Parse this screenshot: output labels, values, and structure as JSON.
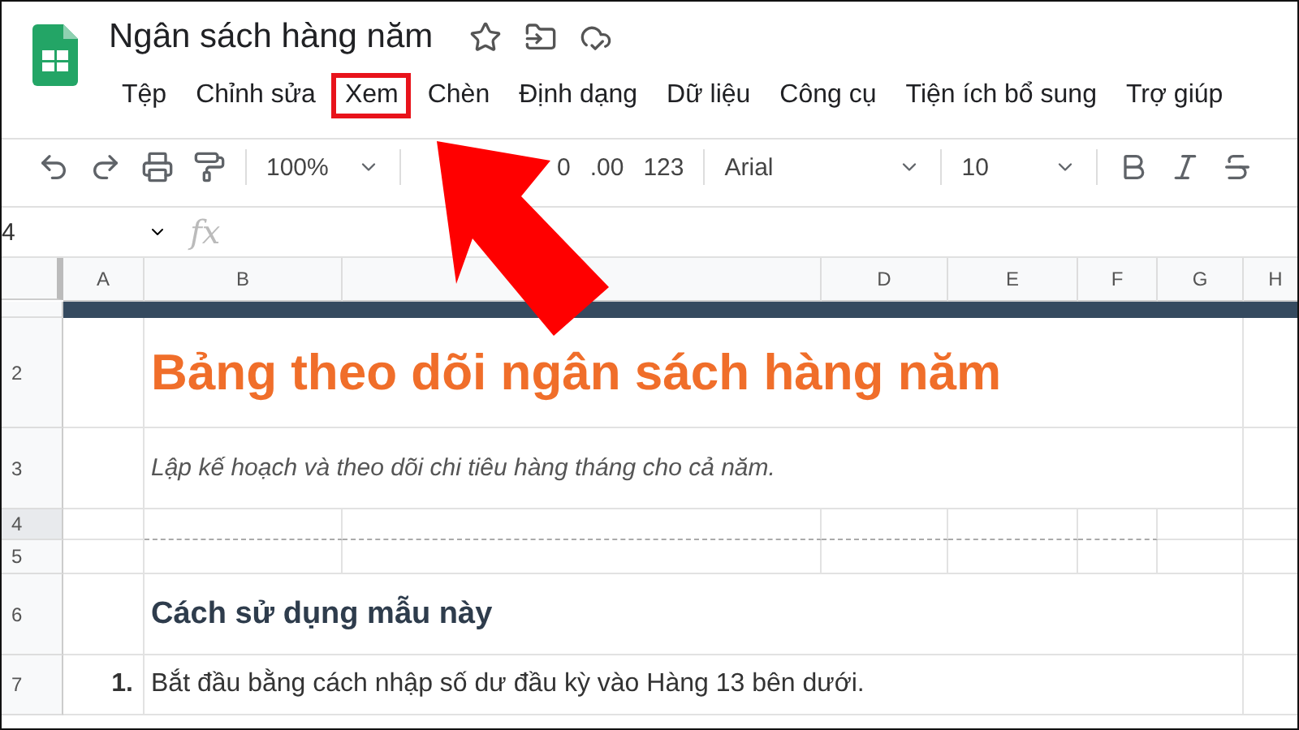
{
  "document": {
    "title": "Ngân sách hàng năm"
  },
  "menu": [
    {
      "label": "Tệp",
      "highlighted": false
    },
    {
      "label": "Chỉnh sửa",
      "highlighted": false
    },
    {
      "label": "Xem",
      "highlighted": true
    },
    {
      "label": "Chèn",
      "highlighted": false
    },
    {
      "label": "Định dạng",
      "highlighted": false
    },
    {
      "label": "Dữ liệu",
      "highlighted": false
    },
    {
      "label": "Công cụ",
      "highlighted": false
    },
    {
      "label": "Tiện ích bổ sung",
      "highlighted": false
    },
    {
      "label": "Trợ giúp",
      "highlighted": false
    }
  ],
  "toolbar": {
    "zoom": "100%",
    "decrease_decimal": "0",
    "increase_decimal": ".00",
    "number_format": "123",
    "font": "Arial",
    "font_size": "10"
  },
  "formula_bar": {
    "cell_ref": "4",
    "fx": "fx"
  },
  "columns": [
    "A",
    "B",
    "",
    "D",
    "E",
    "F",
    "G",
    "H"
  ],
  "rows": [
    {
      "kind": "band"
    },
    {
      "number": "2",
      "kind": "title",
      "text": "Bảng theo dõi ngân sách hàng năm"
    },
    {
      "number": "3",
      "kind": "subtitle",
      "text": "Lập kế hoạch và theo dõi chi tiêu hàng tháng cho cả năm."
    },
    {
      "number": "4",
      "kind": "dashed",
      "selected": true
    },
    {
      "number": "5",
      "kind": "blank"
    },
    {
      "number": "6",
      "kind": "heading",
      "text": "Cách sử dụng mẫu này"
    },
    {
      "number": "7",
      "kind": "step",
      "index": "1.",
      "text": "Bắt đầu bằng cách nhập số dư đầu kỳ vào Hàng 13 bên dưới."
    }
  ]
}
